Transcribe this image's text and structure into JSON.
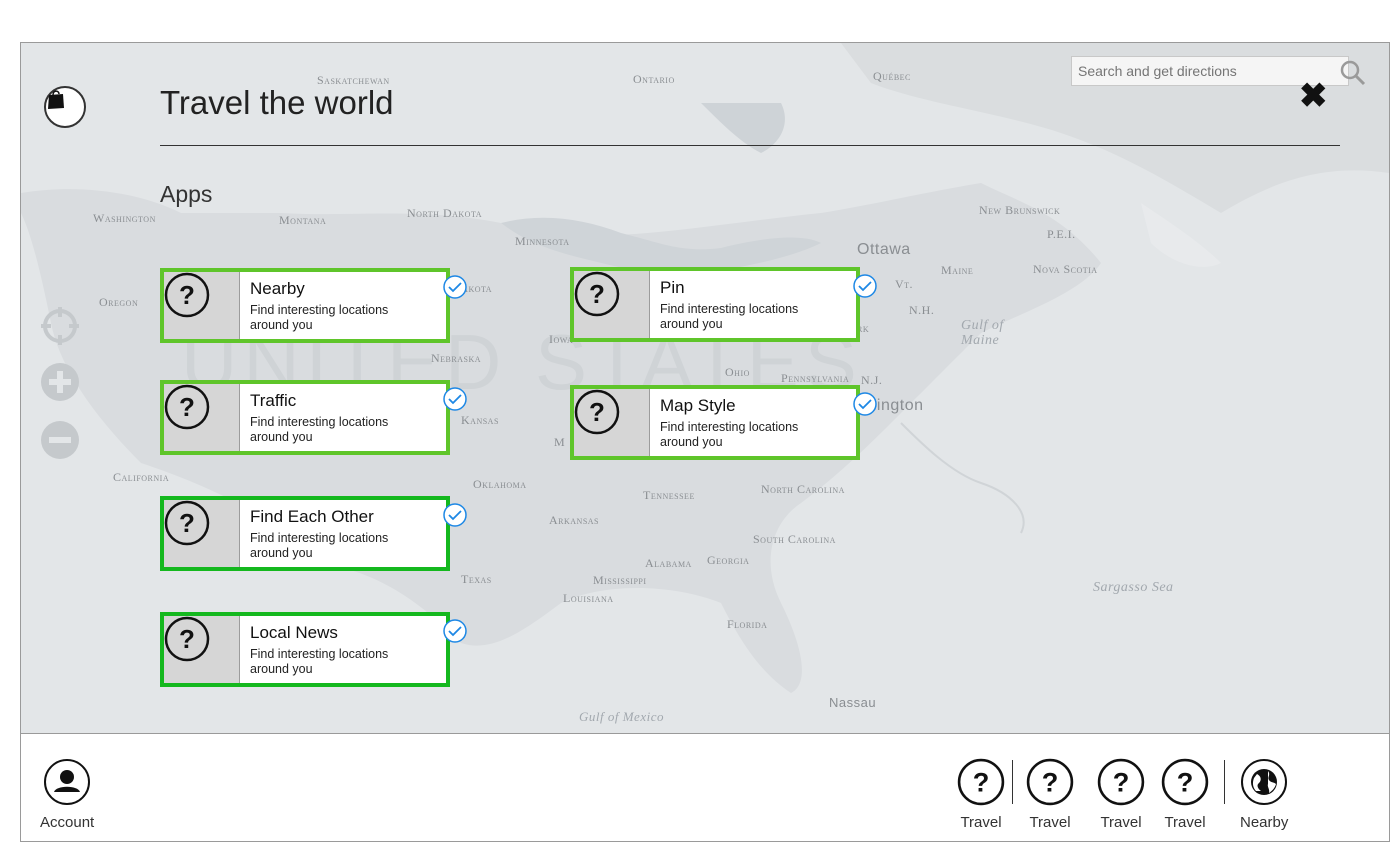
{
  "search": {
    "placeholder": "Search and get directions"
  },
  "header": {
    "title": "Travel the world",
    "close_symbol": "✖"
  },
  "section": {
    "title": "Apps"
  },
  "map": {
    "labels": {
      "saskatchewan": "Saskatchewan",
      "ontario": "Ontario",
      "quebec": "Québec",
      "washington": "Washington",
      "montana": "Montana",
      "north_dakota": "North Dakota",
      "minnesota": "Minnesota",
      "oregon": "Oregon",
      "south_dakota": "Dakota",
      "ottawa": "Ottawa",
      "new_brunswick": "New Brunswick",
      "pei": "P.E.I.",
      "maine": "Maine",
      "nova_scotia": "Nova Scotia",
      "vt": "Vt.",
      "nh": "N.H.",
      "gulf_of_maine": "Gulf of Maine",
      "united_states": "UNITED STATES",
      "nebraska": "Nebraska",
      "iowa": "Iowa",
      "ohio": "Ohio",
      "pennsylvania": "Pennsylvania",
      "nj": "N.J.",
      "washington_dc": "shington",
      "kansas": "Kansas",
      "california": "California",
      "oklahoma": "Oklahoma",
      "tennessee": "Tennessee",
      "north_carolina": "North Carolina",
      "arkansas": "Arkansas",
      "south_carolina": "South Carolina",
      "texas": "Texas",
      "mississippi": "Mississippi",
      "alabama": "Alabama",
      "georgia": "Georgia",
      "louisiana": "Louisiana",
      "florida": "Florida",
      "sargasso": "Sargasso Sea",
      "nassau": "Nassau",
      "gulf_of_mexico": "Gulf of Mexico",
      "mo": "M",
      "york": "rk"
    }
  },
  "map_controls": {
    "locate_icon": "crosshair-icon",
    "zoom_in_icon": "plus-circle-icon",
    "zoom_out_icon": "minus-circle-icon"
  },
  "apps": [
    {
      "name": "Nearby",
      "description": "Find interesting locations around you",
      "icon": "question-icon",
      "checked": true
    },
    {
      "name": "Traffic",
      "description": "Find interesting locations around you",
      "icon": "question-icon",
      "checked": true
    },
    {
      "name": "Find Each Other",
      "description": "Find interesting locations around you",
      "icon": "question-icon",
      "checked": true
    },
    {
      "name": "Local News",
      "description": "Find interesting locations around you",
      "icon": "question-icon",
      "checked": true
    },
    {
      "name": "Pin",
      "description": "Find interesting locations around you",
      "icon": "question-icon",
      "checked": true
    },
    {
      "name": "Map Style",
      "description": "Find interesting locations around you",
      "icon": "question-icon",
      "checked": true
    }
  ],
  "bottombar": {
    "account_label": "Account",
    "items": [
      {
        "label": "Travel",
        "icon": "question-icon"
      },
      {
        "label": "Travel",
        "icon": "question-icon"
      },
      {
        "label": "Travel",
        "icon": "question-icon"
      },
      {
        "label": "Travel",
        "icon": "question-icon"
      },
      {
        "label": "Nearby",
        "icon": "globe-icon"
      }
    ]
  },
  "colors": {
    "tile_border_light": "#5fc52a",
    "tile_border_dark": "#14b81e",
    "check_blue": "#1e88e5",
    "map_bg": "#dfe3e6"
  }
}
